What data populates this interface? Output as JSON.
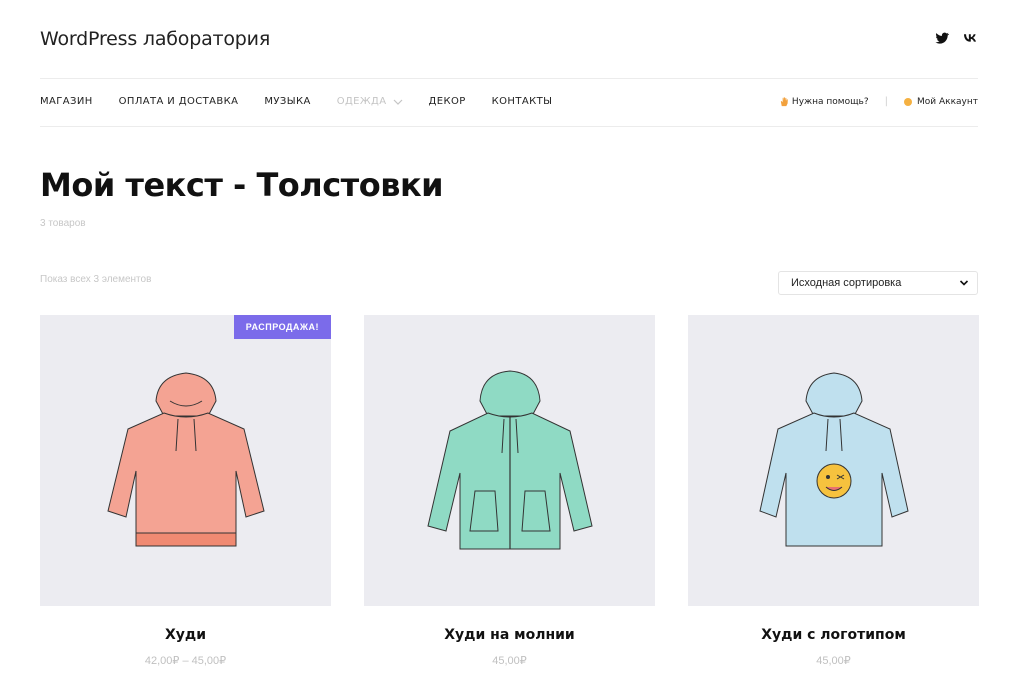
{
  "site": {
    "title": "WordPress лаборатория"
  },
  "social": [
    {
      "name": "twitter",
      "icon": "twitter-icon"
    },
    {
      "name": "vk",
      "icon": "vk-icon"
    }
  ],
  "nav": {
    "items": [
      {
        "label": "МАГАЗИН"
      },
      {
        "label": "ОПЛАТА И ДОСТАВКА"
      },
      {
        "label": "МУЗЫКА"
      },
      {
        "label": "ОДЕЖДА",
        "has_dropdown": true,
        "state": "active-muted"
      },
      {
        "label": "ДЕКОР"
      },
      {
        "label": "КОНТАКТЫ"
      }
    ]
  },
  "utility": {
    "help_label": "Нужна помощь?",
    "separator": "|",
    "account_label": "Мой Аккаунт"
  },
  "page": {
    "title": "Мой текст - Толстовки",
    "product_count": "3 товаров",
    "showing_text": "Показ всех 3 элементов"
  },
  "sort": {
    "selected": "Исходная сортировка"
  },
  "products": [
    {
      "name": "Худи",
      "price": "42,00₽ – 45,00₽",
      "badge": "РАСПРОДАЖА!",
      "color": "#f4a393"
    },
    {
      "name": "Худи на молнии",
      "price": "45,00₽",
      "badge": "",
      "color": "#8fdac4"
    },
    {
      "name": "Худи с логотипом",
      "price": "45,00₽",
      "badge": "",
      "color": "#bfe0ee"
    }
  ],
  "colors": {
    "accent": "#7b6bea",
    "account_dot": "#f5b142",
    "image_bg": "#ececf1"
  }
}
